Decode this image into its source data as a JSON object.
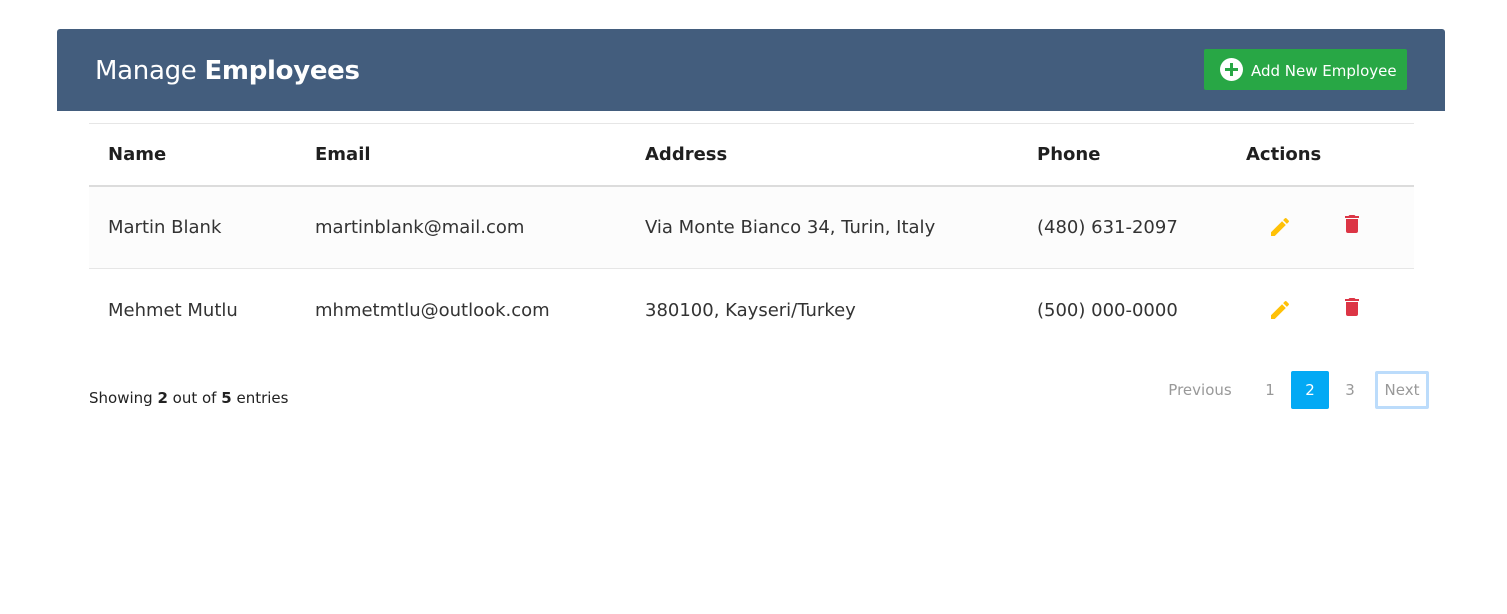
{
  "header": {
    "title_light": "Manage",
    "title_bold": "Employees",
    "add_button_label": "Add New Employee",
    "add_button_icon": "plus-circle-icon"
  },
  "table": {
    "columns": [
      "Name",
      "Email",
      "Address",
      "Phone",
      "Actions"
    ],
    "rows": [
      {
        "name": "Martin Blank",
        "email": "martinblank@mail.com",
        "address": "Via Monte Bianco 34, Turin, Italy",
        "phone": "(480) 631-2097"
      },
      {
        "name": "Mehmet Mutlu",
        "email": "mhmetmtlu@outlook.com",
        "address": "380100, Kayseri/Turkey",
        "phone": "(500) 000-0000"
      }
    ],
    "action_icons": {
      "edit": "pencil-icon",
      "delete": "trash-icon"
    }
  },
  "footer": {
    "showing_prefix": "Showing",
    "shown_count": "2",
    "out_of": "out of",
    "total_count": "5",
    "entries": "entries"
  },
  "pagination": {
    "previous": "Previous",
    "pages": [
      "1",
      "2",
      "3"
    ],
    "active_page": "2",
    "next": "Next"
  },
  "colors": {
    "header_bg": "#435d7d",
    "add_button": "#28a745",
    "edit_icon": "#ffc107",
    "delete_icon": "#dc3545",
    "active_page": "#03a9f4"
  }
}
